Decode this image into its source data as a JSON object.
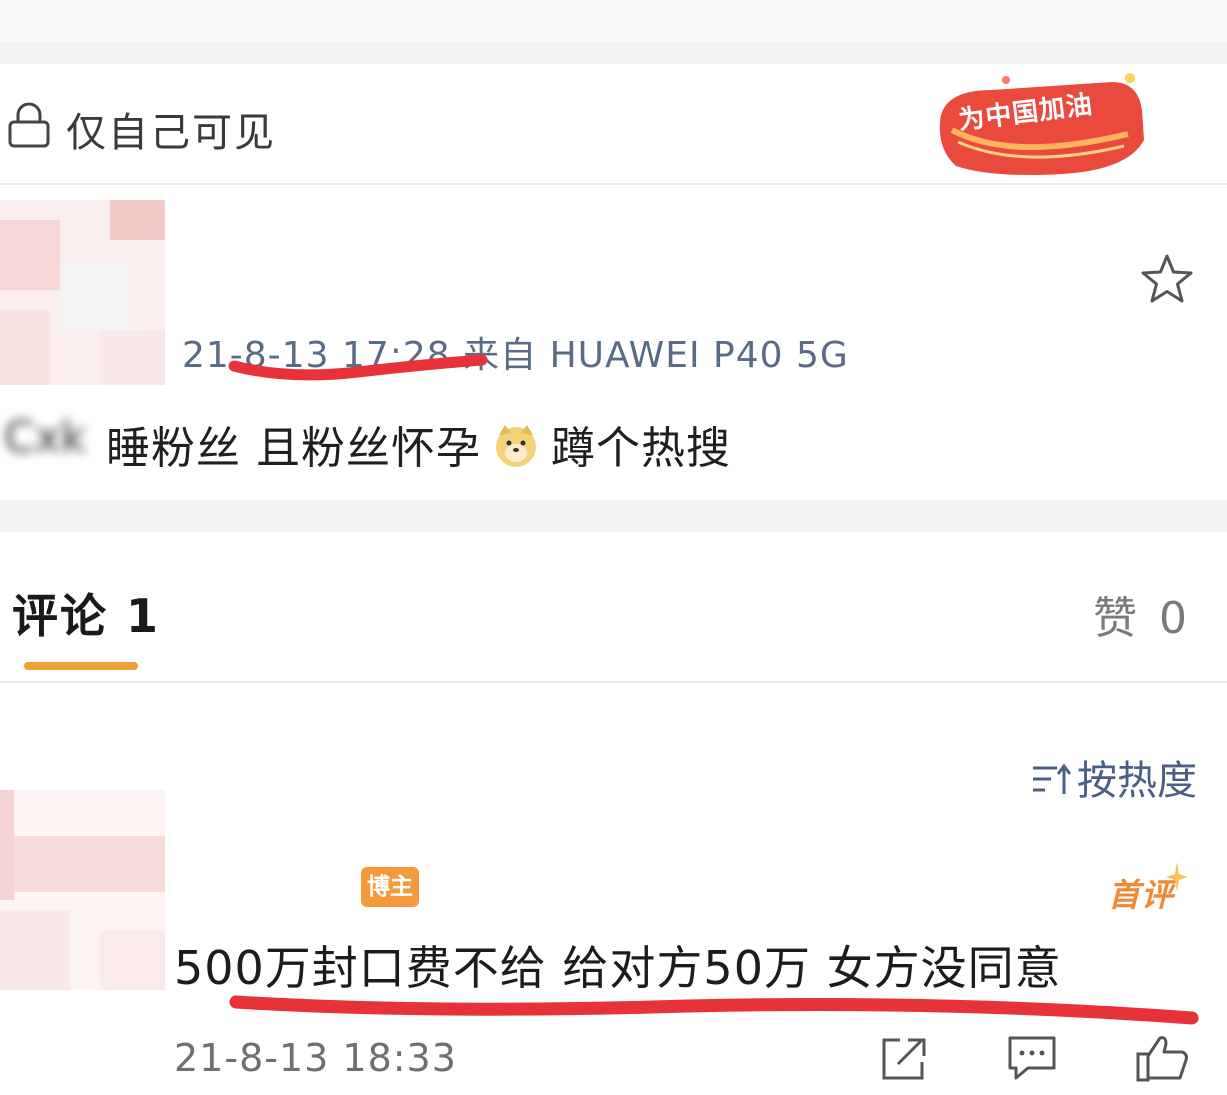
{
  "privacy": {
    "label": "仅自己可见",
    "icon": "lock-icon"
  },
  "badge": {
    "text": "为中国加油"
  },
  "post": {
    "meta": "21-8-13 17:28  来自 HUAWEI P40 5G",
    "author_name_blurred": "Cxk",
    "body_part1": "睡粉丝 且粉丝怀孕",
    "body_part2": "蹲个热搜",
    "emoji": "doge-emoji"
  },
  "comments_tab": {
    "label": "评论 1"
  },
  "likes": {
    "label": "赞 0"
  },
  "sort": {
    "label": "按热度",
    "icon": "sort-icon"
  },
  "comment": {
    "blogger_tag": "博主",
    "first_tag": "首评",
    "text": "500万封口费不给 给对方50万 女方没同意",
    "time": "21-8-13 18:33"
  },
  "colors": {
    "accent_orange": "#f0a030",
    "link_blue": "#4a5f84",
    "annotation_red": "#e8323a"
  }
}
